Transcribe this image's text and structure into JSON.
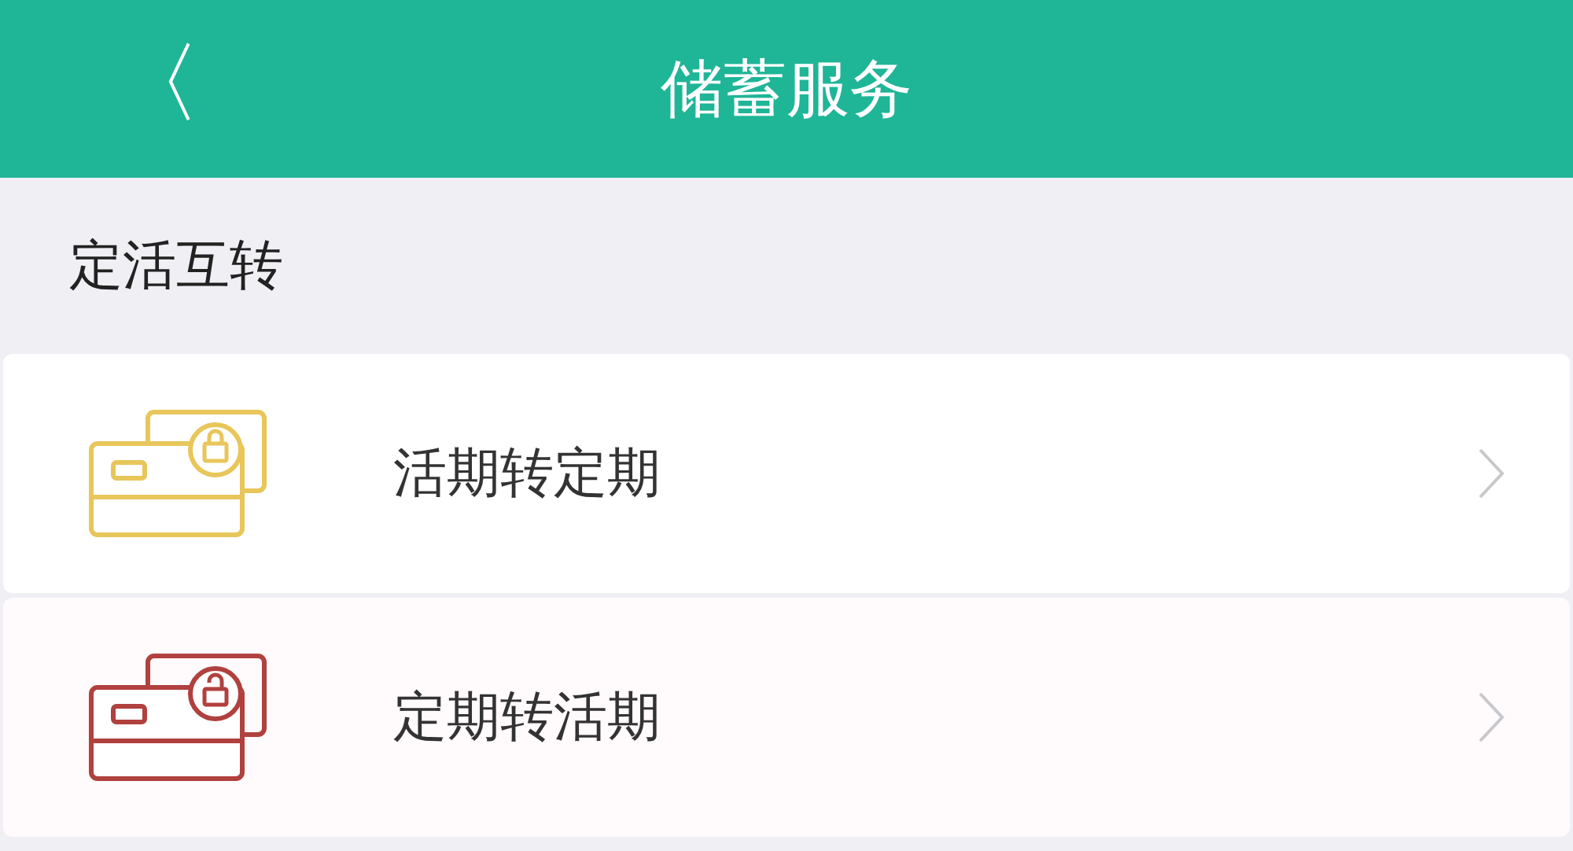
{
  "header": {
    "back_glyph": "〈",
    "title": "储蓄服务"
  },
  "section": {
    "title": "定活互转"
  },
  "items": [
    {
      "label": "活期转定期",
      "kind": "locked",
      "color": "#e8c65a"
    },
    {
      "label": "定期转活期",
      "kind": "unlocked",
      "color": "#b0413e"
    }
  ]
}
